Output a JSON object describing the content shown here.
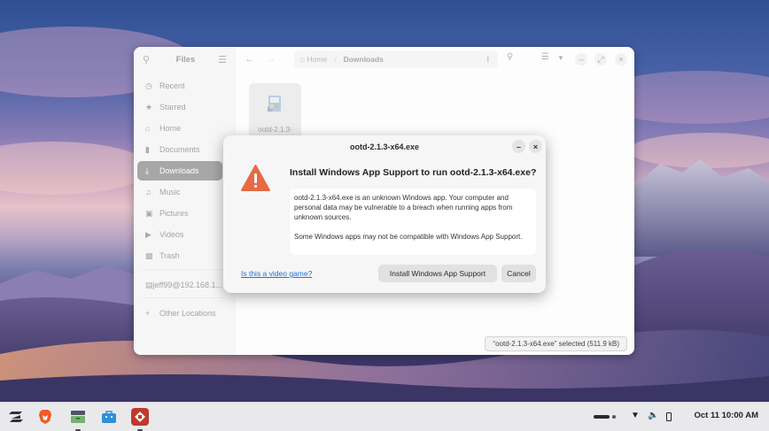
{
  "files_window": {
    "sidebar_title": "Files",
    "sidebar_items": [
      {
        "label": "Recent",
        "icon": "clock-icon"
      },
      {
        "label": "Starred",
        "icon": "star-icon"
      },
      {
        "label": "Home",
        "icon": "home-icon"
      },
      {
        "label": "Documents",
        "icon": "document-icon"
      },
      {
        "label": "Downloads",
        "icon": "download-icon",
        "active": true
      },
      {
        "label": "Music",
        "icon": "music-icon"
      },
      {
        "label": "Pictures",
        "icon": "picture-icon"
      },
      {
        "label": "Videos",
        "icon": "video-icon"
      },
      {
        "label": "Trash",
        "icon": "trash-icon"
      }
    ],
    "network_item": "jeff99@192.168.1...",
    "other_locations": "Other Locations",
    "path": {
      "home": "Home",
      "current": "Downloads"
    },
    "file": {
      "name": "ootd-2.1.3-"
    },
    "status": "“ootd-2.1.3-x64.exe” selected  (511.9 kB)"
  },
  "dialog": {
    "title": "ootd-2.1.3-x64.exe",
    "heading": "Install Windows App Support to run ootd-2.1.3-x64.exe?",
    "body_p1": "ootd-2.1.3-x64.exe is an unknown Windows app. Your computer and personal data may be vulnerable to a breach when running apps from unknown sources.",
    "body_p2": "Some Windows apps may not be compatible with Windows App Support.",
    "link": "Is this a video game?",
    "install_label": "Install Windows App Support",
    "cancel_label": "Cancel",
    "minimize_glyph": "–",
    "close_glyph": "×"
  },
  "taskbar": {
    "clock": "Oct 11  10:00 AM",
    "apps": [
      "zorin-menu-icon",
      "brave-browser-icon",
      "files-icon",
      "software-store-icon",
      "windows-app-icon"
    ]
  },
  "colors": {
    "accent": "#1c71d8",
    "warning": "#e66a44",
    "active_sidebar": "#3d3d3d"
  }
}
